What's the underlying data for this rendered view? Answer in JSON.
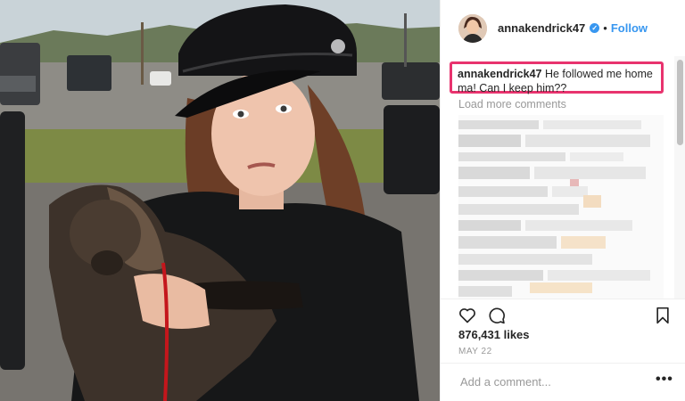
{
  "post": {
    "username": "annakendrick47",
    "verified_icon": "verified-badge-icon",
    "separator": "•",
    "follow_label": "Follow",
    "caption_user": "annakendrick47",
    "caption_text": " He followed me home ma! Can I keep him??",
    "load_more_label": "Load more comments",
    "likes": "876,431 likes",
    "date": "MAY 22",
    "comment_placeholder": "Add a comment...",
    "more_options": "•••"
  },
  "icons": {
    "like": "heart-icon",
    "comment": "comment-bubble-icon",
    "save": "bookmark-icon"
  },
  "colors": {
    "accent": "#3897f0",
    "highlight": "#e8336e",
    "muted": "#999999",
    "text": "#262626"
  }
}
